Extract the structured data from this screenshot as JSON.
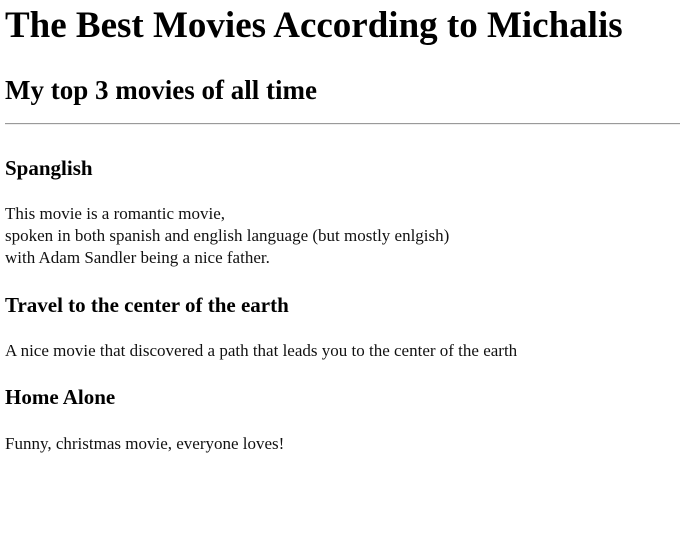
{
  "page": {
    "title": "The Best Movies According to Michalis",
    "subtitle": "My top 3 movies of all time"
  },
  "movies": [
    {
      "title": "Spanglish",
      "description_lines": [
        "This movie is a romantic movie,",
        "spoken in both spanish and english language (but mostly enlgish)",
        "with Adam Sandler being a nice father."
      ]
    },
    {
      "title": "Travel to the center of the earth",
      "description_lines": [
        "A nice movie that discovered a path that leads you to the center of the earth"
      ]
    },
    {
      "title": "Home Alone",
      "description_lines": [
        "Funny, christmas movie, everyone loves!"
      ]
    }
  ]
}
